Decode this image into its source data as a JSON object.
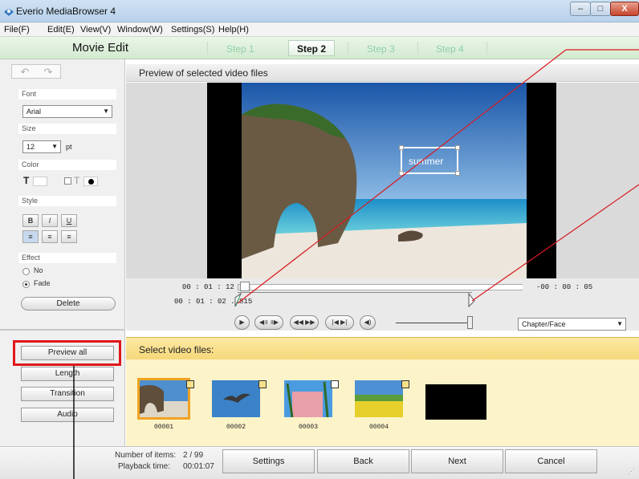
{
  "window": {
    "title": "Everio MediaBrowser 4",
    "minimize": "–",
    "maximize": "□",
    "close": "X"
  },
  "menu": [
    "File(F)",
    "Edit(E)",
    "View(V)",
    "Window(W)",
    "Settings(S)",
    "Help(H)"
  ],
  "steps": {
    "mode_title": "Movie Edit",
    "items": [
      "Step 1",
      "Step 2",
      "Step 3",
      "Step 4"
    ],
    "active": "Step 2"
  },
  "edit_panel": {
    "undo": "↶",
    "redo": "↷",
    "font_label": "Font",
    "font_value": "Arial",
    "size_label": "Size",
    "size_value": "12",
    "size_unit": "pt",
    "color_label": "Color",
    "style_label": "Style",
    "bold": "B",
    "italic": "I",
    "underline": "U",
    "effect_label": "Effect",
    "effect_no": "No",
    "effect_fade": "Fade",
    "effect_selected": "Fade",
    "delete": "Delete"
  },
  "side_buttons": [
    "Preview all",
    "Length",
    "Transition",
    "Audio"
  ],
  "preview": {
    "title": "Preview of selected video files",
    "caption": "summer",
    "time_current": "00 : 01 : 12",
    "time_remaining": "-00 : 00 : 05",
    "time_trim": "00 : 01 : 02 .1815",
    "chapter_mode": "Chapter/Face"
  },
  "select": {
    "title": "Select video files:",
    "thumbnails": [
      {
        "label": "00001",
        "selected": true
      },
      {
        "label": "00002",
        "selected": false
      },
      {
        "label": "00003",
        "selected": false
      },
      {
        "label": "00004",
        "selected": false
      }
    ]
  },
  "footer": {
    "items_label": "Number of items:",
    "items_value": "2 / 99",
    "playback_label": "Playback time:",
    "playback_value": "00:01:07",
    "buttons": [
      "Settings",
      "Back",
      "Next",
      "Cancel"
    ]
  },
  "colors": {
    "highlight": "#e0161b",
    "annotation": "#d81a20",
    "selected_thumb": "#f0a321"
  }
}
